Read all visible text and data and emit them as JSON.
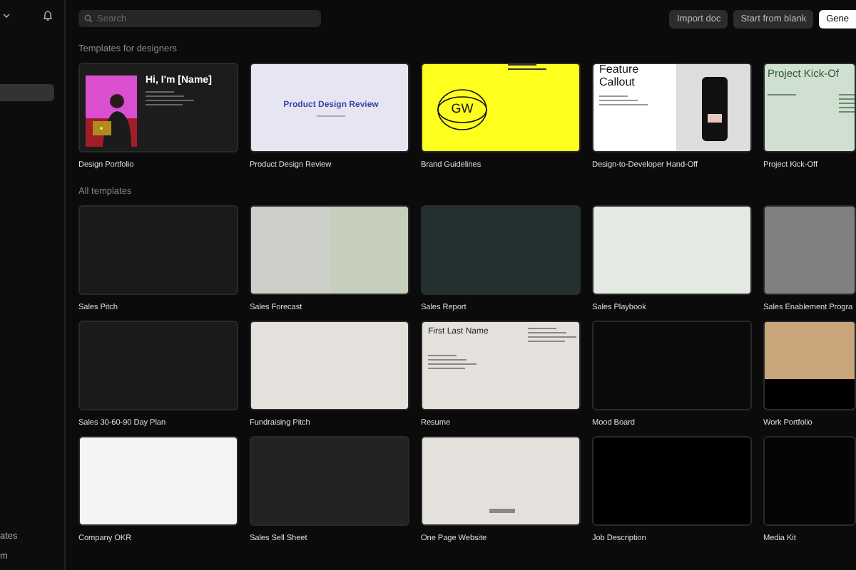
{
  "sidebar": {
    "nav_items": [
      {
        "selected": true
      }
    ],
    "footer_links": [
      "ates",
      "m"
    ]
  },
  "toolbar": {
    "search": {
      "placeholder": "Search"
    },
    "buttons": [
      {
        "label": "Import doc",
        "kind": "secondary"
      },
      {
        "label": "Start from blank",
        "kind": "secondary"
      },
      {
        "label": "Gene",
        "kind": "primary"
      }
    ]
  },
  "sections": [
    {
      "title": "Templates for designers",
      "templates": [
        {
          "name": "Design Portfolio",
          "thumb": {
            "kind": "portfolio",
            "color": "#1c1c1c",
            "heading": "Hi, I'm [Name]"
          }
        },
        {
          "name": "Product Design Review",
          "thumb": {
            "kind": "title",
            "color": "#e6e6f2",
            "heading": "Product Design Review"
          }
        },
        {
          "name": "Brand Guidelines",
          "thumb": {
            "kind": "brand",
            "color": "#ffff1f",
            "heading": "GW"
          }
        },
        {
          "name": "Design-to-Developer Hand-Off",
          "thumb": {
            "kind": "callout",
            "color": "#ffffff",
            "heading": "Feature Callout"
          }
        },
        {
          "name": "Project Kick-Off",
          "thumb": {
            "kind": "kickoff",
            "color": "#cfe0d0",
            "heading": "Project Kick-Of"
          }
        }
      ]
    },
    {
      "title": "All templates",
      "templates": [
        {
          "name": "Sales Pitch",
          "thumb": {
            "kind": "plain",
            "color": "#1a1a1a"
          }
        },
        {
          "name": "Sales Forecast",
          "thumb": {
            "kind": "split",
            "color": "#c6cfbb"
          }
        },
        {
          "name": "Sales Report",
          "thumb": {
            "kind": "plain",
            "color": "#223030"
          }
        },
        {
          "name": "Sales Playbook",
          "thumb": {
            "kind": "plain",
            "color": "#e2eae1"
          }
        },
        {
          "name": "Sales Enablement Progra",
          "thumb": {
            "kind": "plain",
            "color": "#808080"
          }
        },
        {
          "name": "Sales 30-60-90 Day Plan",
          "thumb": {
            "kind": "plain",
            "color": "#1a1a1a"
          }
        },
        {
          "name": "Fundraising Pitch",
          "thumb": {
            "kind": "plain",
            "color": "#e4e1dc"
          }
        },
        {
          "name": "Resume",
          "thumb": {
            "kind": "resume",
            "color": "#e4e1dc",
            "heading": "First Last Name"
          }
        },
        {
          "name": "Mood Board",
          "thumb": {
            "kind": "plain",
            "color": "#0a0a0a"
          }
        },
        {
          "name": "Work Portfolio",
          "thumb": {
            "kind": "band",
            "color": "#c9a57c"
          }
        },
        {
          "name": "Company OKR",
          "thumb": {
            "kind": "plain",
            "color": "#f4f4f4"
          }
        },
        {
          "name": "Sales Sell Sheet",
          "thumb": {
            "kind": "plain",
            "color": "#232323"
          }
        },
        {
          "name": "One Page Website",
          "thumb": {
            "kind": "website",
            "color": "#e4e1dc"
          }
        },
        {
          "name": "Job Description",
          "thumb": {
            "kind": "plain",
            "color": "#000000"
          }
        },
        {
          "name": "Media Kit",
          "thumb": {
            "kind": "plain",
            "color": "#050505"
          }
        }
      ]
    }
  ]
}
